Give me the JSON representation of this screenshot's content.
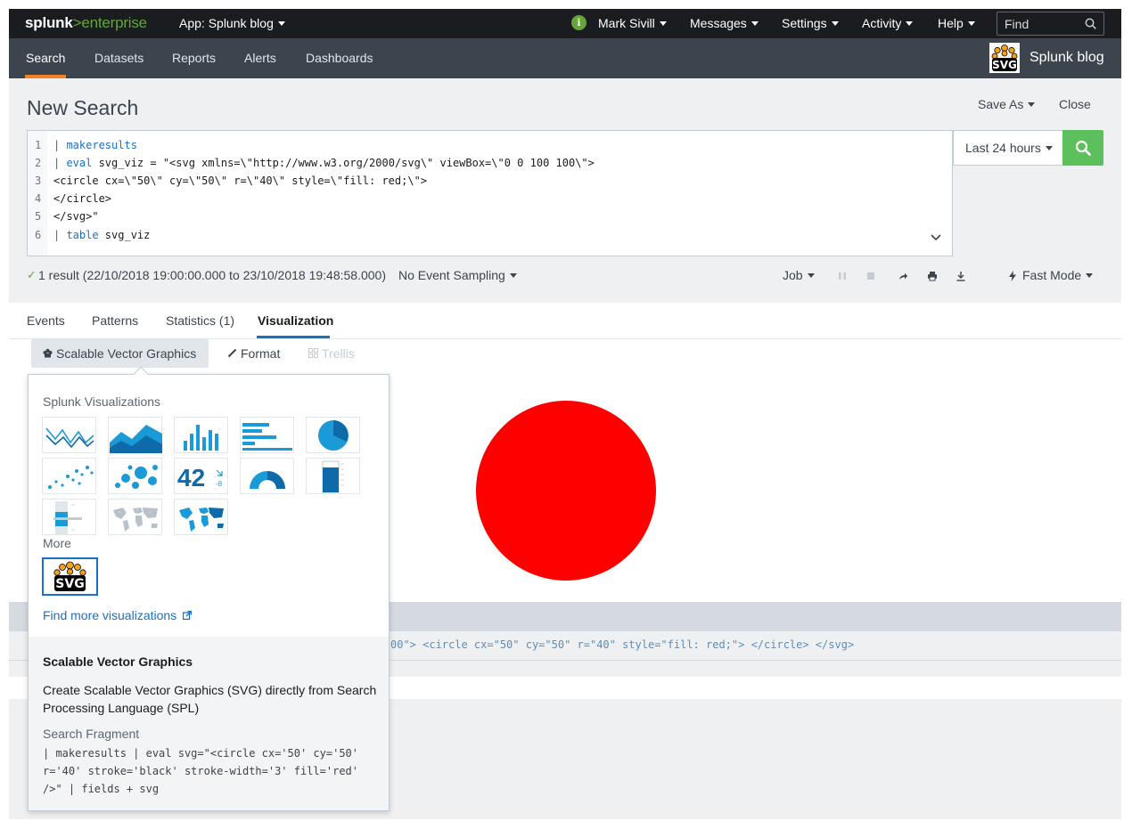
{
  "topbar": {
    "logo_word": "splunk",
    "logo_gt": ">",
    "logo_product": "enterprise",
    "app_menu": "App: Splunk blog",
    "info_letter": "i",
    "user": "Mark Sivill",
    "messages": "Messages",
    "settings": "Settings",
    "activity": "Activity",
    "help": "Help",
    "find_placeholder": "Find"
  },
  "navbar": {
    "tabs": [
      "Search",
      "Datasets",
      "Reports",
      "Alerts",
      "Dashboards"
    ],
    "active_tab": "Search",
    "app_name": "Splunk blog",
    "accent": "#f58220"
  },
  "search": {
    "title": "New Search",
    "save_as": "Save As",
    "close": "Close",
    "time_range": "Last 24 hours",
    "lines": [
      {
        "n": "1",
        "kw": "| makeresults",
        "rest": ""
      },
      {
        "n": "2",
        "kw": "| eval",
        "rest": " svg_viz = \"<svg xmlns=\\\"http://www.w3.org/2000/svg\\\" viewBox=\\\"0 0 100 100\\\">"
      },
      {
        "n": "3",
        "kw": "",
        "rest": "<circle cx=\\\"50\\\" cy=\\\"50\\\" r=\\\"40\\\" style=\\\"fill: red;\\\">"
      },
      {
        "n": "4",
        "kw": "",
        "rest": "</circle>"
      },
      {
        "n": "5",
        "kw": "",
        "rest": "</svg>\""
      },
      {
        "n": "6",
        "kw": "| table",
        "rest": " svg_viz"
      }
    ]
  },
  "status": {
    "result": "1 result (22/10/2018 19:00:00.000 to 23/10/2018 19:48:58.000)",
    "sampling": "No Event Sampling",
    "job": "Job",
    "mode": "Fast Mode"
  },
  "result_tabs": [
    "Events",
    "Patterns",
    "Statistics (1)",
    "Visualization"
  ],
  "active_result_tab": "Visualization",
  "viz_toolbar": {
    "picker": "Scalable Vector Graphics",
    "format": "Format",
    "trellis": "Trellis"
  },
  "viz": {
    "fill": "#ff0000"
  },
  "table": {
    "cell": "00\"> <circle cx=\"50\" cy=\"50\" r=\"40\" style=\"fill: red;\"> </circle> </svg>"
  },
  "popover": {
    "section_splunk": "Splunk Visualizations",
    "thumb_single_value": "42",
    "thumb_single_delta": "-8",
    "section_more": "More",
    "more_icon_label": "SVG",
    "find_more": "Find more visualizations",
    "selected_title": "Scalable Vector Graphics",
    "selected_desc": "Create Scalable Vector Graphics (SVG) directly from Search Processing Language (SPL)",
    "fragment_label": "Search Fragment",
    "fragment": "| makeresults | eval svg=\"<circle cx='50' cy='50'\nr='40' stroke='black' stroke-width='3' fill='red'\n/>\" | fields + svg"
  }
}
